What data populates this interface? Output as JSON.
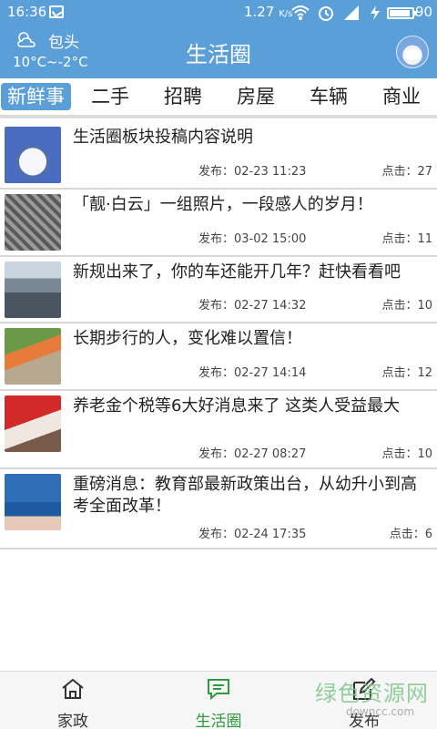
{
  "status_bar": {
    "time": "16:36",
    "speed": "1.27",
    "speed_unit": "K/s",
    "battery": "90"
  },
  "header": {
    "city": "包头",
    "temperature": "10°C~-2°C",
    "title": "生活圈"
  },
  "tabs": [
    {
      "label": "新鲜事",
      "active": true
    },
    {
      "label": "二手",
      "active": false
    },
    {
      "label": "招聘",
      "active": false
    },
    {
      "label": "房屋",
      "active": false
    },
    {
      "label": "车辆",
      "active": false
    },
    {
      "label": "商业",
      "active": false
    }
  ],
  "posts": [
    {
      "title": "生活圈板块投稿内容说明",
      "date": "发布：02-23  11:23",
      "clicks": "点击：27",
      "thumb": "cat-with-blue-hat"
    },
    {
      "title": "「靓·白云」一组照片，一段感人的岁月！",
      "date": "发布：03-02  15:00",
      "clicks": "点击：11",
      "thumb": "black-white-crowd"
    },
    {
      "title": "新规出来了，你的车还能开几年？赶快看看吧",
      "date": "发布：02-27  14:32",
      "clicks": "点击：10",
      "thumb": "scrapped-cars"
    },
    {
      "title": "长期步行的人，变化难以置信！",
      "date": "发布：02-27  14:14",
      "clicks": "点击：12",
      "thumb": "walking-legs"
    },
    {
      "title": "养老金个税等6大好消息来了  这类人受益最大",
      "date": "发布：02-27  08:27",
      "clicks": "点击：10",
      "thumb": "red-sign-crowd"
    },
    {
      "title": "重磅消息：教育部最新政策出台，从幼升小到高考全面改革！",
      "date": "发布：02-24  17:35",
      "clicks": "点击：6",
      "thumb": "press-conference"
    }
  ],
  "bottom_nav": [
    {
      "label": "家政",
      "icon": "home-icon",
      "active": false
    },
    {
      "label": "生活圈",
      "icon": "chat-icon",
      "active": true
    },
    {
      "label": "发布",
      "icon": "edit-icon",
      "active": false
    }
  ],
  "watermark": {
    "text": "绿色资源网",
    "url": "downcc.com"
  },
  "colors": {
    "primary": "#5b9fd8",
    "active_nav": "#2f9a3d"
  }
}
